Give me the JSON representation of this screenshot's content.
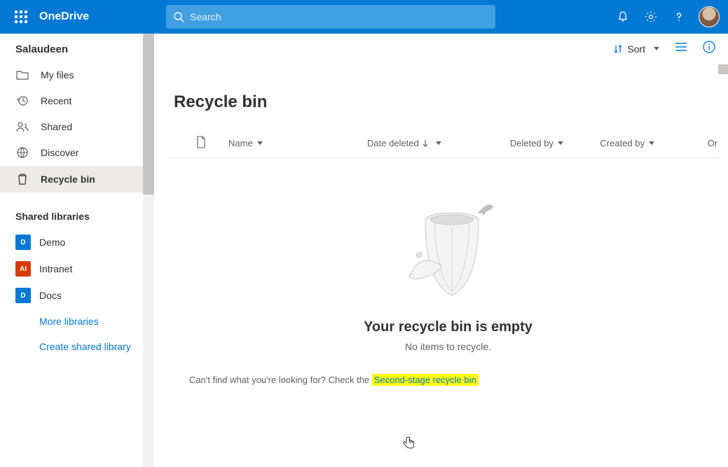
{
  "header": {
    "brand": "OneDrive",
    "search_placeholder": "Search"
  },
  "sidebar": {
    "user": "Salaudeen",
    "items": [
      {
        "label": "My files"
      },
      {
        "label": "Recent"
      },
      {
        "label": "Shared"
      },
      {
        "label": "Discover"
      },
      {
        "label": "Recycle bin"
      }
    ],
    "shared_title": "Shared libraries",
    "libs": [
      {
        "initial": "D",
        "label": "Demo",
        "color": "#0078d4"
      },
      {
        "initial": "AI",
        "label": "Intranet",
        "color": "#d83b01"
      },
      {
        "initial": "D",
        "label": "Docs",
        "color": "#0078d4"
      }
    ],
    "more_libraries": "More libraries",
    "create_library": "Create shared library"
  },
  "commandbar": {
    "sort_label": "Sort"
  },
  "page": {
    "title": "Recycle bin",
    "columns": {
      "name": "Name",
      "date_deleted": "Date deleted",
      "deleted_by": "Deleted by",
      "created_by": "Created by",
      "original": "Ori"
    },
    "empty_title": "Your recycle bin is empty",
    "empty_sub": "No items to recycle.",
    "bottom_prefix": "Can't find what you're looking for? Check the ",
    "second_stage": "Second-stage recycle bin"
  }
}
